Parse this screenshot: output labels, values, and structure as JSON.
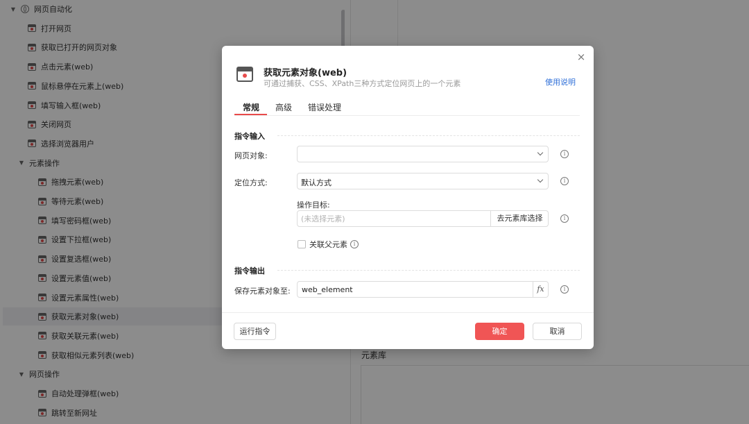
{
  "sidebar": {
    "groups": [
      {
        "label": "网页自动化",
        "items": [
          "打开网页",
          "获取已打开的网页对象",
          "点击元素(web)",
          "鼠标悬停在元素上(web)",
          "填写输入框(web)",
          "关闭网页",
          "选择浏览器用户"
        ]
      },
      {
        "label": "元素操作",
        "items": [
          "拖拽元素(web)",
          "等待元素(web)",
          "填写密码框(web)",
          "设置下拉框(web)",
          "设置复选框(web)",
          "设置元素值(web)",
          "设置元素属性(web)",
          "获取元素对象(web)",
          "获取关联元素(web)",
          "获取相似元素列表(web)"
        ]
      },
      {
        "label": "网页操作",
        "items": [
          "自动处理弹框(web)",
          "跳转至新网址"
        ]
      }
    ],
    "selected_item": "获取元素对象(web)"
  },
  "right_panel": {
    "element_library_title": "元素库"
  },
  "dialog": {
    "close_label": "×",
    "title": "获取元素对象(web)",
    "subtitle": "可通过捕获、CSS、XPath三种方式定位网页上的一个元素",
    "help_link": "使用说明",
    "tabs": [
      "常规",
      "高级",
      "错误处理"
    ],
    "active_tab": "常规",
    "sections": {
      "input_title": "指令输入",
      "output_title": "指令输出"
    },
    "fields": {
      "web_object_label": "网页对象:",
      "web_object_value": "",
      "locate_label": "定位方式:",
      "locate_value": "默认方式",
      "target_label": "操作目标:",
      "target_placeholder": "(未选择元素)",
      "target_button": "去元素库选择",
      "parent_checkbox_label": "关联父元素",
      "parent_checked": false,
      "save_label": "保存元素对象至:",
      "save_value": "web_element",
      "fx_label": "fx"
    },
    "footer": {
      "run_label": "运行指令",
      "ok_label": "确定",
      "cancel_label": "取消"
    },
    "colors": {
      "accent": "#f05555",
      "link": "#2f6fd8"
    }
  }
}
